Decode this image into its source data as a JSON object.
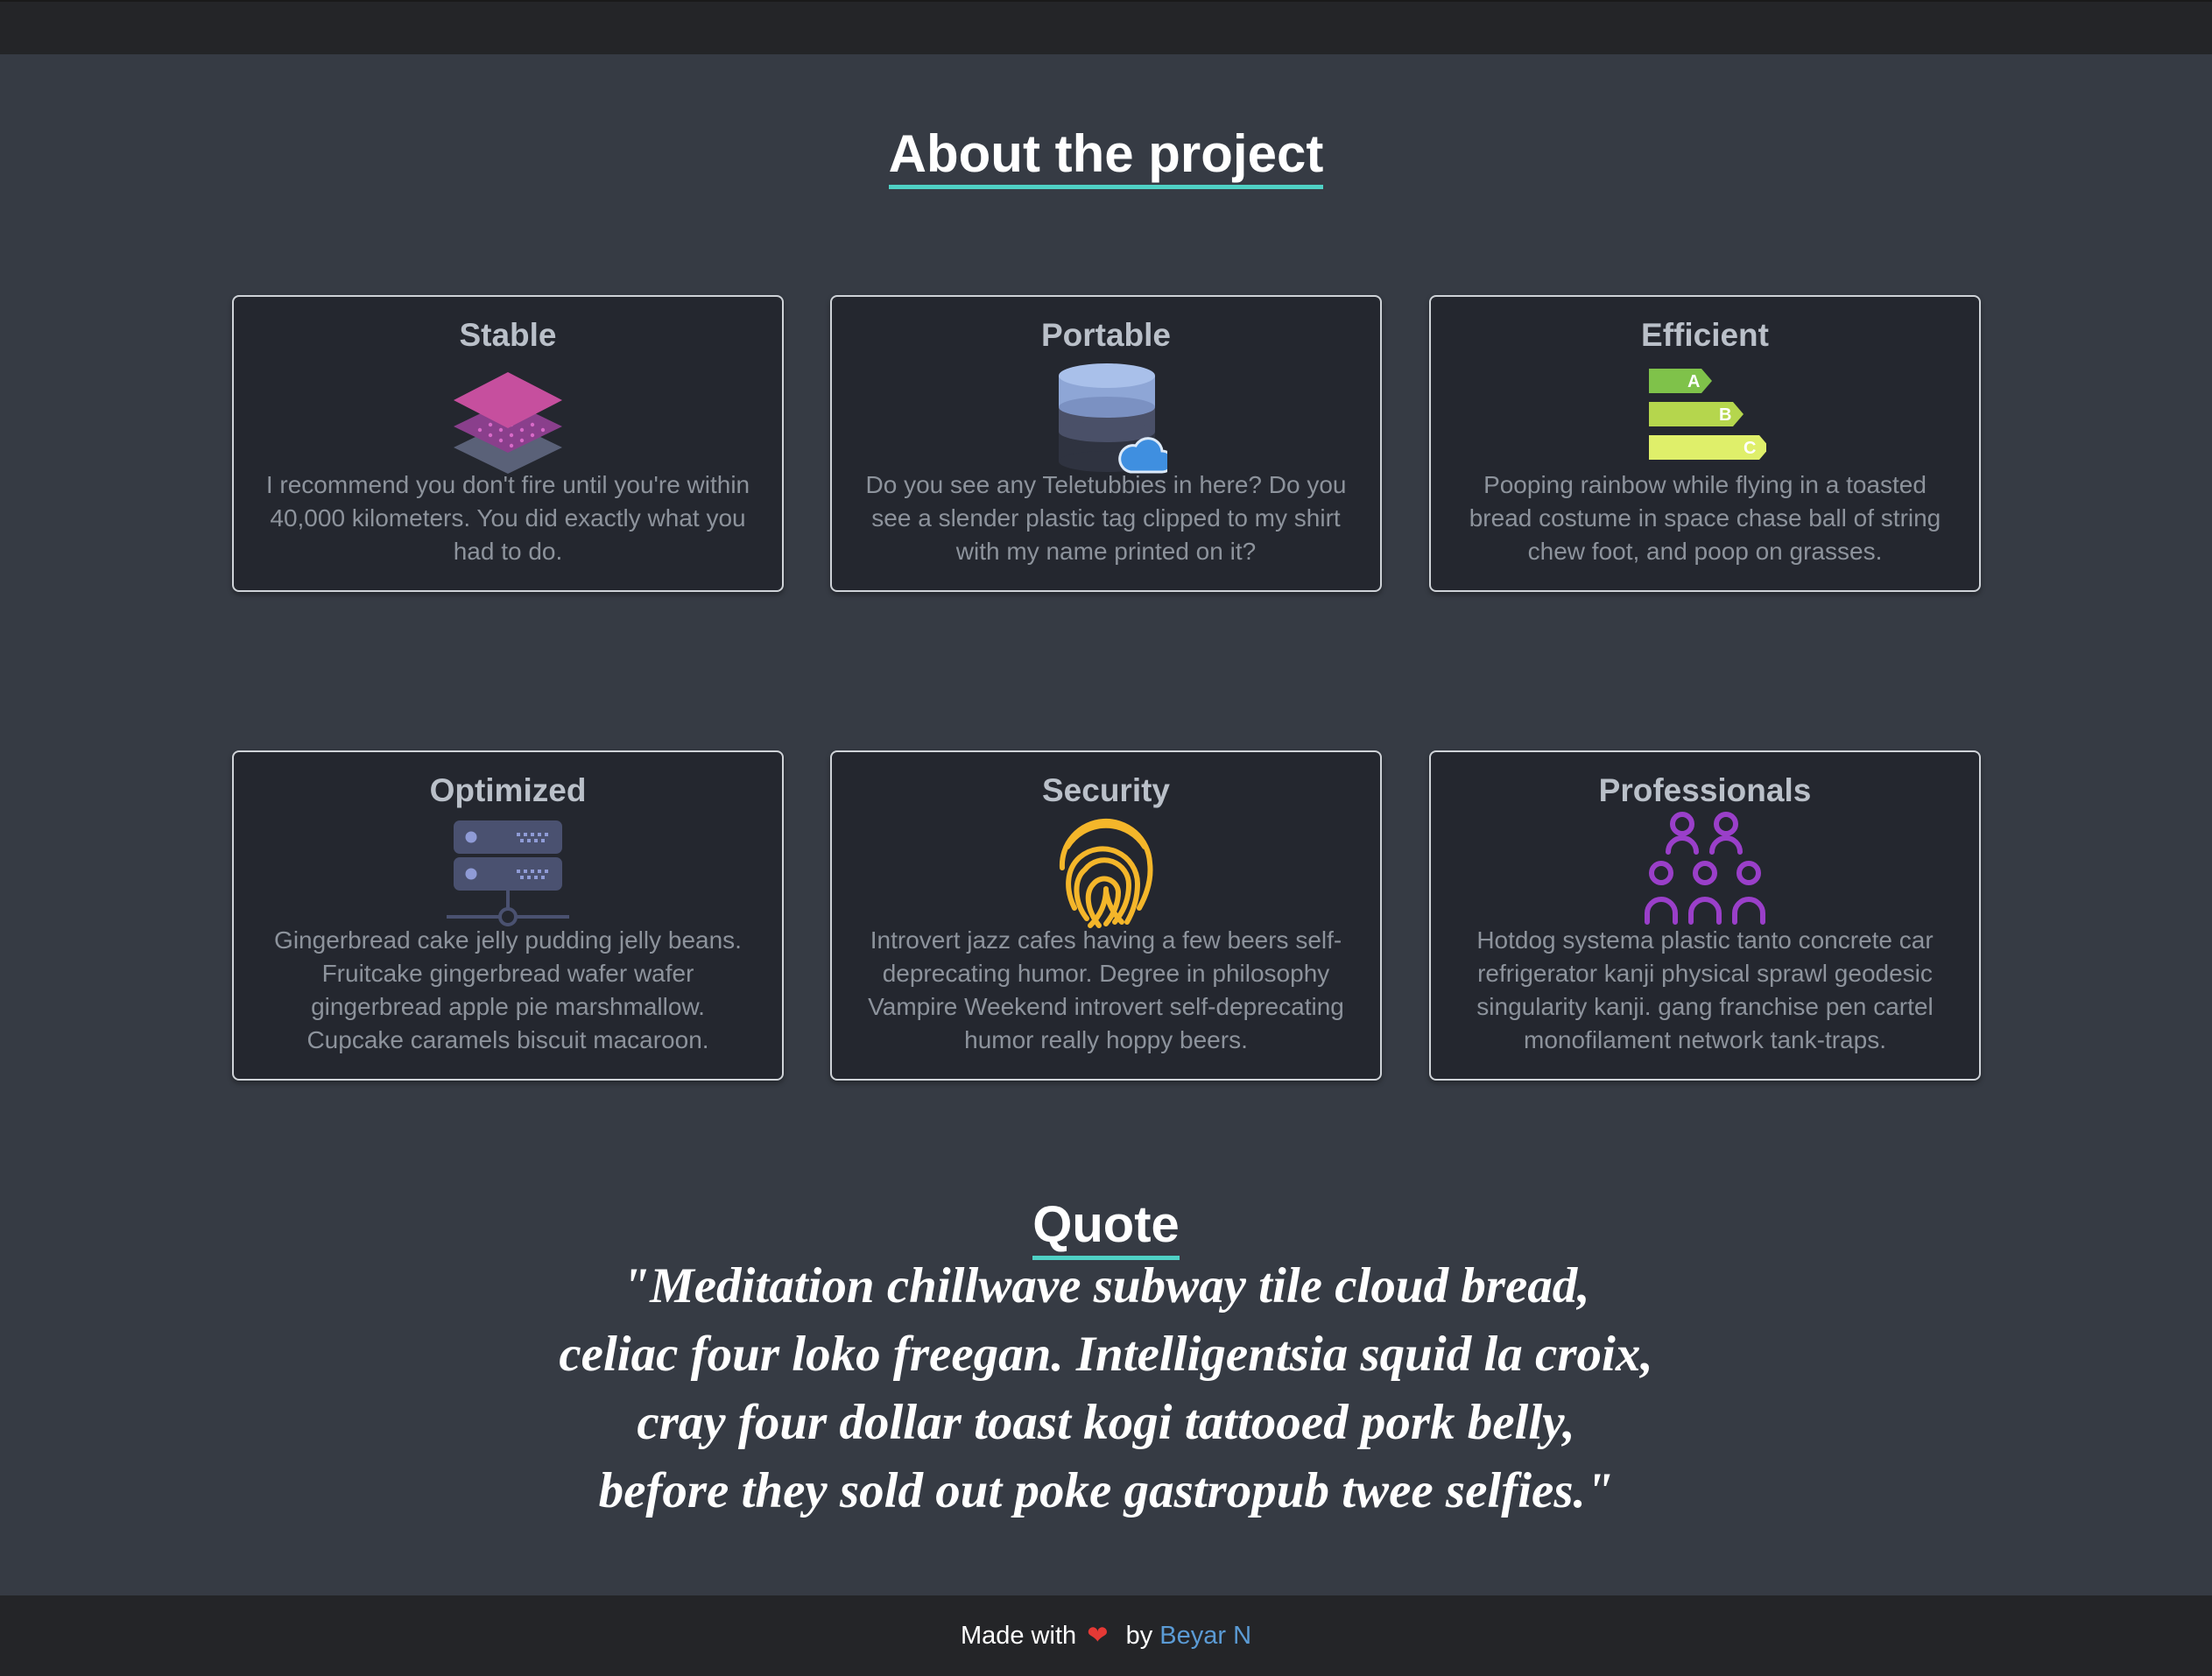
{
  "header": {
    "about_title": "About the project"
  },
  "features": [
    {
      "title": "Stable",
      "icon": "layers-icon",
      "text": "I recommend you don't fire until you're within 40,000 kilometers. You did exactly what you had to do."
    },
    {
      "title": "Portable",
      "icon": "database-cloud-icon",
      "text": "Do you see any Teletubbies in here? Do you see a slender plastic tag clipped to my shirt with my name printed on it?"
    },
    {
      "title": "Efficient",
      "icon": "energy-rating-icon",
      "text": "Pooping rainbow while flying in a toasted bread costume in space chase ball of string chew foot, and poop on grasses."
    },
    {
      "title": "Optimized",
      "icon": "server-icon",
      "text": "Gingerbread cake jelly pudding jelly beans. Fruitcake gingerbread wafer wafer gingerbread apple pie marshmallow. Cupcake caramels biscuit macaroon."
    },
    {
      "title": "Security",
      "icon": "fingerprint-icon",
      "text": "Introvert jazz cafes having a few beers self-deprecating humor. Degree in philosophy Vampire Weekend introvert self-deprecating humor really hoppy beers."
    },
    {
      "title": "Professionals",
      "icon": "people-group-icon",
      "text": "Hotdog systema plastic tanto concrete car refrigerator kanji physical sprawl geodesic singularity kanji. gang franchise pen cartel monofilament network tank-traps."
    }
  ],
  "energy_labels": [
    "A",
    "B",
    "C"
  ],
  "quote": {
    "title": "Quote",
    "lines": [
      "\"Meditation chillwave subway tile cloud bread,",
      "celiac four loko freegan. Intelligentsia squid la croix,",
      "cray four dollar toast kogi tattooed pork belly,",
      "before they sold out poke gastropub twee selfies.\""
    ]
  },
  "footer": {
    "made_with": "Made with",
    "heart": "❤",
    "by": "by",
    "author": "Beyar N"
  },
  "colors": {
    "accent_underline": "#4fd1c5",
    "link": "#5b9bd5",
    "heart": "#e53935"
  }
}
